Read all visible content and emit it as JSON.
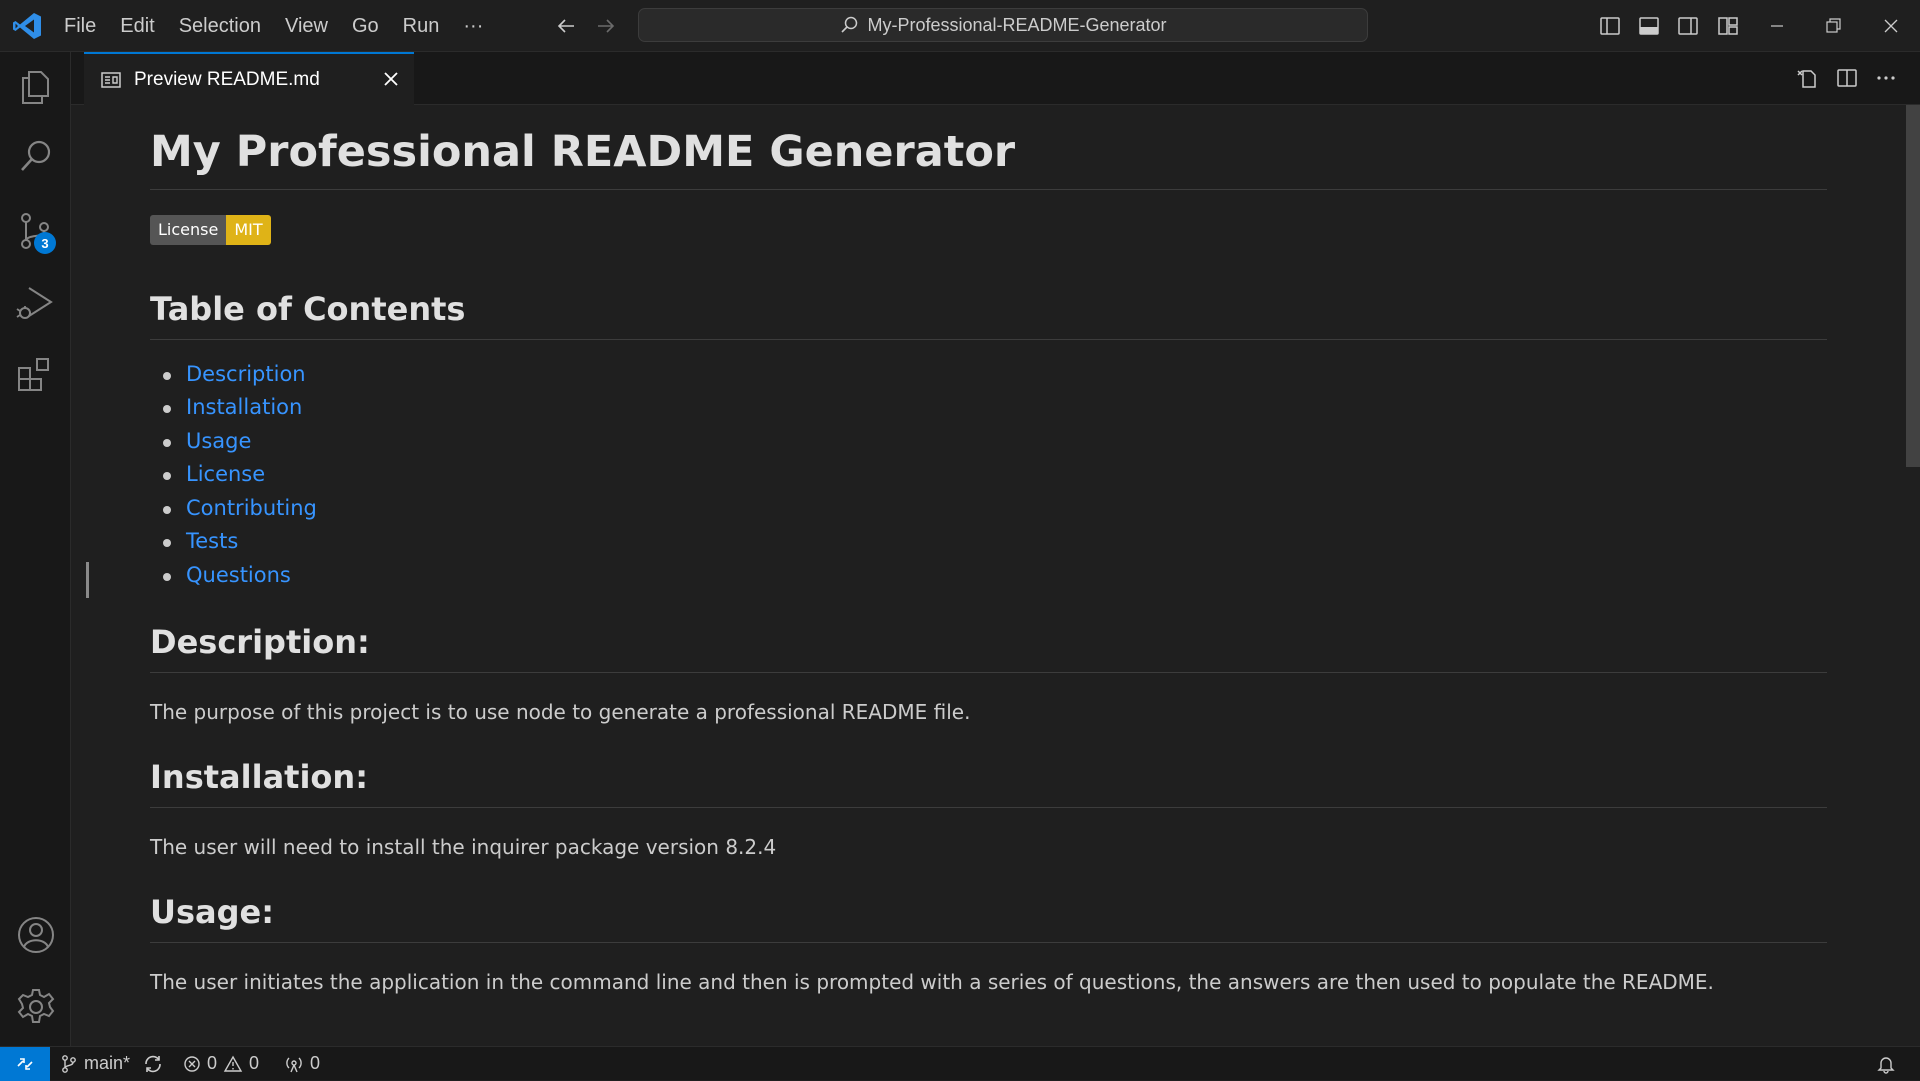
{
  "colors": {
    "accent": "#0078d4",
    "link": "#3794ff",
    "badge_license": "#555555",
    "badge_mit": "#dfb317"
  },
  "menu": [
    "File",
    "Edit",
    "Selection",
    "View",
    "Go",
    "Run",
    "···"
  ],
  "search": {
    "label": "My-Professional-README-Generator"
  },
  "activity_bar": {
    "items": [
      "explorer-icon",
      "search-icon",
      "source-control-icon",
      "run-debug-icon",
      "extensions-icon"
    ],
    "source_control_badge": "3",
    "bottom": [
      "account-icon",
      "settings-gear-icon"
    ]
  },
  "tab": {
    "label": "Preview README.md"
  },
  "readme": {
    "title": "My Professional README Generator",
    "badge": {
      "label": "License",
      "value": "MIT"
    },
    "toc_title": "Table of Contents",
    "toc": [
      "Description",
      "Installation",
      "Usage",
      "License",
      "Contributing",
      "Tests",
      "Questions"
    ],
    "sections": [
      {
        "heading": "Description:",
        "body": "The purpose of this project is to use node to generate a professional README file."
      },
      {
        "heading": "Installation:",
        "body": "The user will need to install the inquirer package version 8.2.4"
      },
      {
        "heading": "Usage:",
        "body": "The user initiates the application in the command line and then is prompted with a series of questions, the answers are then used to populate the README."
      }
    ]
  },
  "status": {
    "branch": "main*",
    "errors": "0",
    "warnings": "0",
    "ports": "0"
  }
}
